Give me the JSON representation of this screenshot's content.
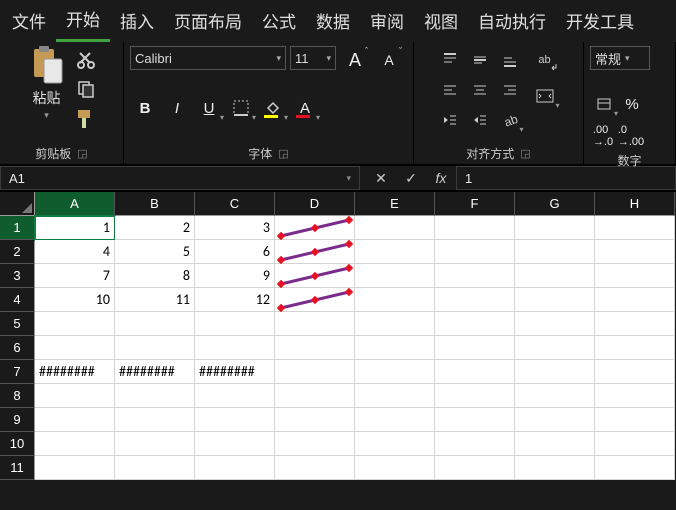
{
  "tabs": [
    "文件",
    "开始",
    "插入",
    "页面布局",
    "公式",
    "数据",
    "审阅",
    "视图",
    "自动执行",
    "开发工具"
  ],
  "active_tab": 1,
  "clipboard": {
    "label": "剪贴板",
    "paste": "粘贴"
  },
  "font": {
    "label": "字体",
    "name": "Calibri",
    "size": "11",
    "bold": "B",
    "italic": "I",
    "underline": "U",
    "grow": "A",
    "shrink": "A"
  },
  "align": {
    "label": "对齐方式",
    "wrap": "ab"
  },
  "number": {
    "label": "数字",
    "format": "常规",
    "percent": "%"
  },
  "namebox": "A1",
  "formula": "1",
  "fx": "fx",
  "columns": [
    "A",
    "B",
    "C",
    "D",
    "E",
    "F",
    "G",
    "H"
  ],
  "rows": [
    1,
    2,
    3,
    4,
    5,
    6,
    7,
    8,
    9,
    10,
    11
  ],
  "active_cell": {
    "row": 0,
    "col": 0
  },
  "cells": {
    "0": {
      "0": "1",
      "1": "2",
      "2": "3"
    },
    "1": {
      "0": "4",
      "1": "5",
      "2": "6"
    },
    "2": {
      "0": "7",
      "1": "8",
      "2": "9"
    },
    "3": {
      "0": "10",
      "1": "11",
      "2": "12"
    },
    "6": {
      "0": "########",
      "1": "########",
      "2": "########"
    }
  },
  "chart_data": {
    "type": "line",
    "note": "Column D contains win/loss sparklines for rows 1–4",
    "series": [
      {
        "row": 1,
        "values": [
          1,
          2,
          3
        ]
      },
      {
        "row": 2,
        "values": [
          4,
          5,
          6
        ]
      },
      {
        "row": 3,
        "values": [
          7,
          8,
          9
        ]
      },
      {
        "row": 4,
        "values": [
          10,
          11,
          12
        ]
      }
    ]
  }
}
